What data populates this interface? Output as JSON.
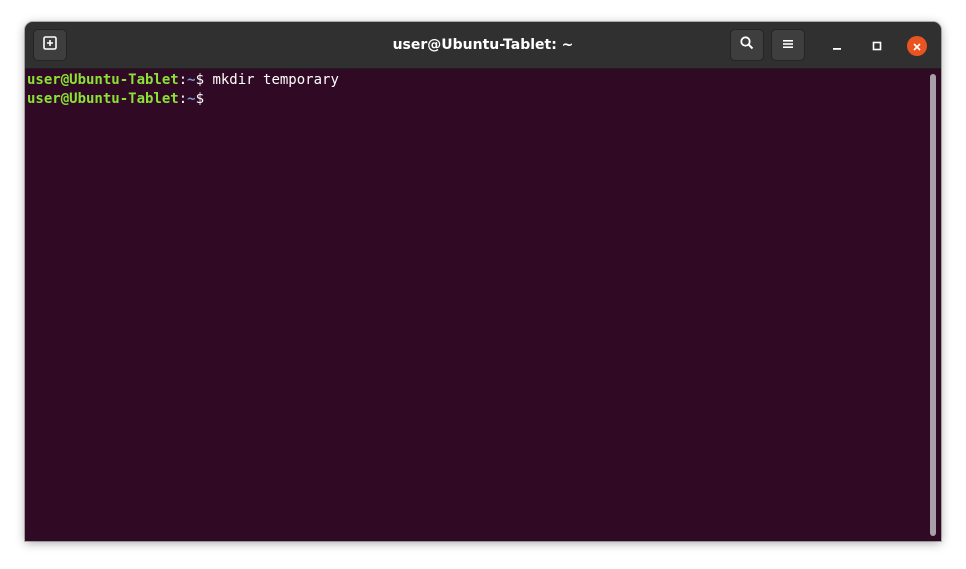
{
  "window": {
    "title": "user@Ubuntu-Tablet: ~"
  },
  "headerbar": {
    "new_tab_icon": "new-tab-icon",
    "search_icon": "search-icon",
    "menu_icon": "hamburger-menu-icon",
    "minimize_icon": "minimize-icon",
    "maximize_icon": "maximize-icon",
    "close_icon": "close-icon"
  },
  "terminal": {
    "lines": [
      {
        "user_host": "user@Ubuntu-Tablet",
        "colon": ":",
        "path": "~",
        "dollar": "$ ",
        "command": "mkdir temporary"
      },
      {
        "user_host": "user@Ubuntu-Tablet",
        "colon": ":",
        "path": "~",
        "dollar": "$",
        "command": ""
      }
    ]
  },
  "colors": {
    "terminal_bg": "#300a24",
    "prompt_user": "#8ae234",
    "prompt_path": "#729fcf",
    "close_button": "#e95420",
    "headerbar_bg": "#303030"
  }
}
